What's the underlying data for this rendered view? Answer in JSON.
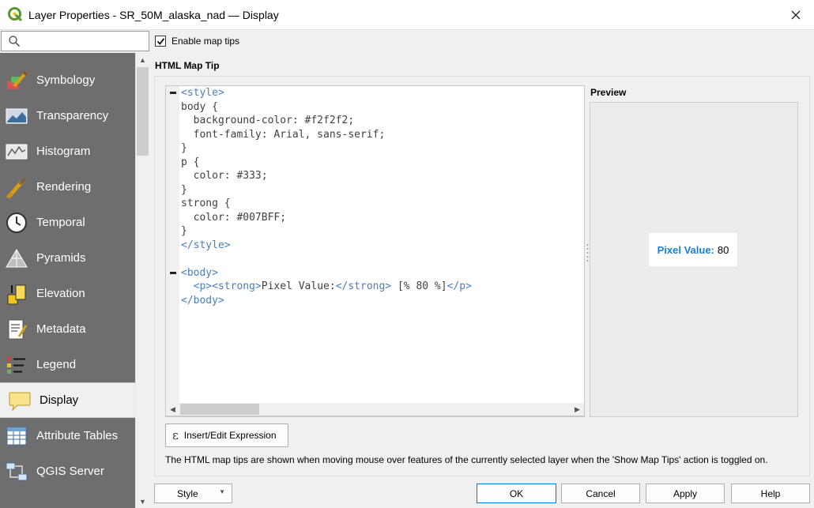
{
  "window": {
    "title": "Layer Properties - SR_50M_alaska_nad — Display"
  },
  "sidebar": {
    "search_placeholder": "",
    "items": [
      {
        "label": "Symbology",
        "icon": "symbology-icon"
      },
      {
        "label": "Transparency",
        "icon": "transparency-icon"
      },
      {
        "label": "Histogram",
        "icon": "histogram-icon"
      },
      {
        "label": "Rendering",
        "icon": "rendering-icon"
      },
      {
        "label": "Temporal",
        "icon": "temporal-icon"
      },
      {
        "label": "Pyramids",
        "icon": "pyramids-icon"
      },
      {
        "label": "Elevation",
        "icon": "elevation-icon"
      },
      {
        "label": "Metadata",
        "icon": "metadata-icon"
      },
      {
        "label": "Legend",
        "icon": "legend-icon"
      },
      {
        "label": "Display",
        "icon": "display-icon",
        "selected": true
      },
      {
        "label": "Attribute Tables",
        "icon": "attribute-tables-icon"
      },
      {
        "label": "QGIS Server",
        "icon": "qgis-server-icon"
      }
    ]
  },
  "display": {
    "enable_map_tips_label": "Enable map tips",
    "enable_map_tips_checked": true,
    "section_title": "HTML Map Tip",
    "preview_title": "Preview",
    "preview_strong": "Pixel Value:",
    "preview_value": "80",
    "insert_expression_label": "Insert/Edit Expression",
    "help_text": "The HTML map tips are shown when moving mouse over features of the currently selected layer when the 'Show Map Tips' action is toggled on."
  },
  "code": {
    "lines": [
      "<style>",
      "body {",
      "  background-color: #f2f2f2;",
      "  font-family: Arial, sans-serif;",
      "}",
      "p {",
      "  color: #333;",
      "}",
      "strong {",
      "  color: #007BFF;",
      "}",
      "</style>",
      "",
      "<body>",
      "  <p><strong>Pixel Value:</strong> [% 80 %]</p>",
      "</body>"
    ]
  },
  "buttons": {
    "style": "Style",
    "ok": "OK",
    "cancel": "Cancel",
    "apply": "Apply",
    "help": "Help"
  },
  "colors": {
    "sidebar_bg": "#6e6e6e",
    "code_tag": "#4a7ec2",
    "preview_strong": "#1a7fd4",
    "default_button_border": "#0078d7"
  }
}
